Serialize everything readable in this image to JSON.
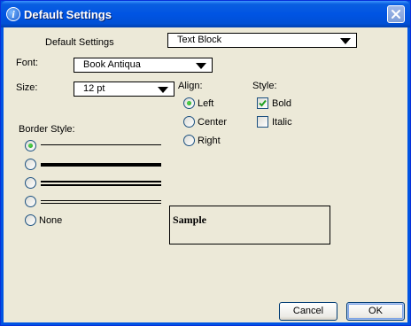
{
  "window": {
    "title": "Default Settings"
  },
  "settings_for": {
    "label": "Default Settings",
    "value": "Text Block"
  },
  "font": {
    "label": "Font:",
    "value": "Book Antiqua"
  },
  "size": {
    "label": "Size:",
    "value": "12 pt"
  },
  "align": {
    "label": "Align:",
    "options": [
      "Left",
      "Center",
      "Right"
    ],
    "selected": "Left"
  },
  "style": {
    "label": "Style:",
    "bold": {
      "label": "Bold",
      "checked": true
    },
    "italic": {
      "label": "Italic",
      "checked": false
    }
  },
  "border_style": {
    "label": "Border Style:",
    "options": [
      "thin line",
      "thick line",
      "double line",
      "thin double line",
      "None"
    ],
    "none_label": "None",
    "selected": "thin line"
  },
  "sample": {
    "text": "Sample"
  },
  "buttons": {
    "cancel": "Cancel",
    "ok": "OK"
  },
  "colors": {
    "title_bar": "#0054e3",
    "dialog_bg": "#ece9d8",
    "radio_dot": "#21a121",
    "check_mark": "#21a121"
  },
  "icons": {
    "title": "info-icon",
    "close": "close-icon",
    "dropdown": "chevron-down-icon"
  }
}
